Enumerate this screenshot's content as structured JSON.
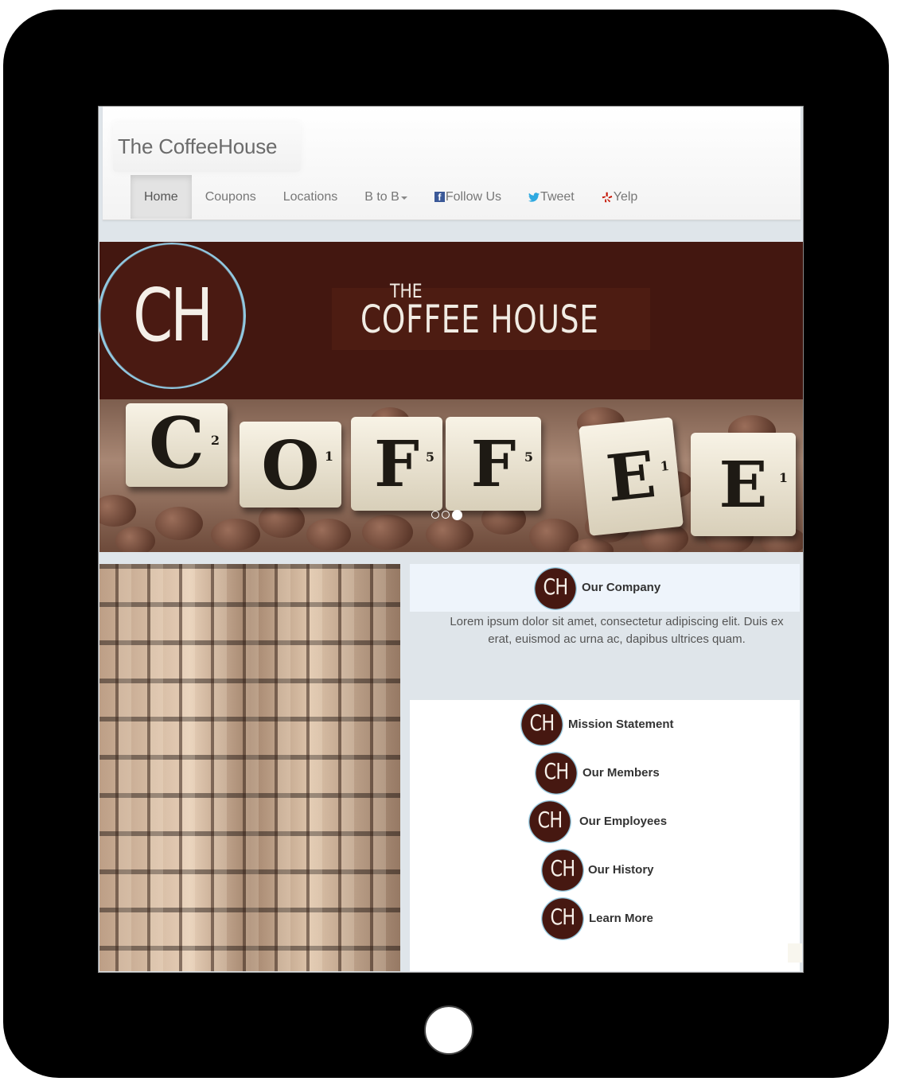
{
  "brand": {
    "name": "The CoffeeHouse"
  },
  "nav": {
    "home": "Home",
    "coupons": "Coupons",
    "locations": "Locations",
    "b2b": "B to B",
    "follow": "Follow Us",
    "tweet": "Tweet",
    "yelp": "Yelp",
    "icons": {
      "follow": "facebook-icon",
      "tweet": "twitter-icon",
      "yelp": "yelp-icon",
      "b2b": "caret-down-icon"
    }
  },
  "hero": {
    "logo": "CH",
    "the": "THE",
    "title": "COFFEE HOUSE",
    "tiles": [
      "C",
      "O",
      "F",
      "F",
      "E",
      "E"
    ],
    "tile_subs": [
      "2",
      "1",
      "5",
      "5",
      "1",
      "1"
    ],
    "slide_count": 3,
    "active_slide": 3
  },
  "company": {
    "badge": "CH",
    "title": "Our Company",
    "body": "Lorem ipsum dolor sit amet, consectetur adipiscing elit. Duis ex erat, euismod ac urna ac, dapibus ultrices quam."
  },
  "links": {
    "badge": "CH",
    "mission": "Mission Statement",
    "members": "Our Members",
    "employees": "Our Employees",
    "history": "Our History",
    "learn": "Learn More"
  },
  "colors": {
    "brown": "#431710",
    "light_blue": "#9acde3",
    "panel": "#dfe5ea"
  }
}
